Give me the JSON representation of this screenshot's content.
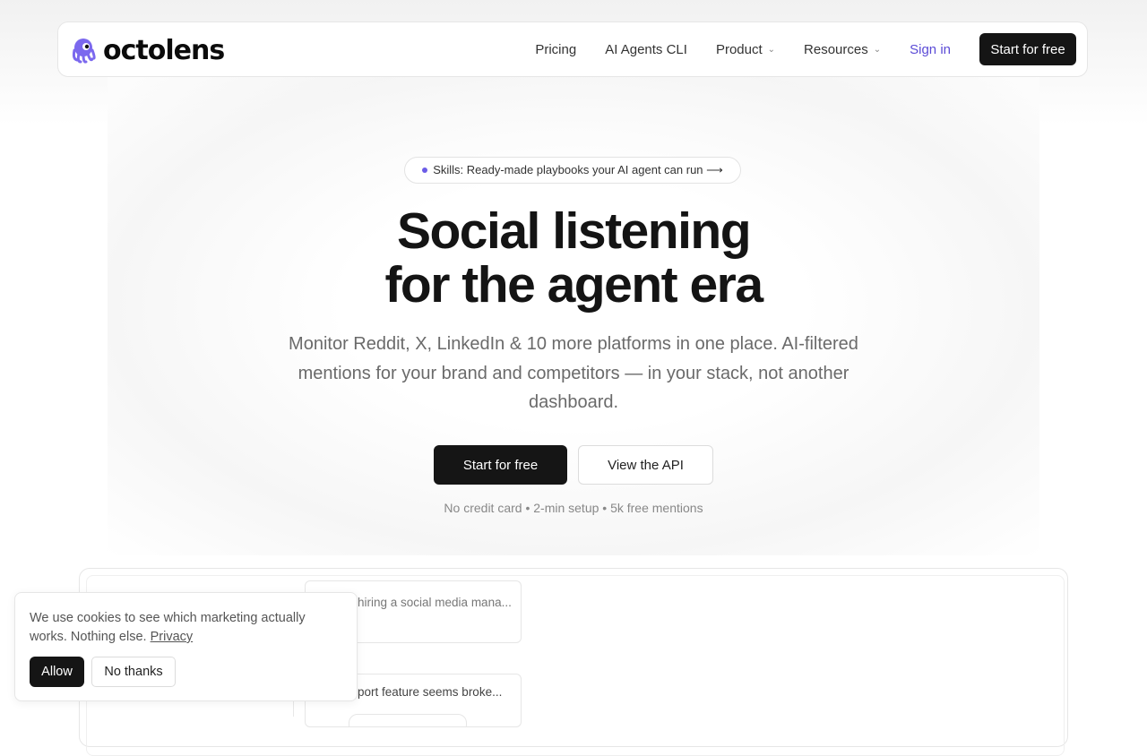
{
  "brand": {
    "name": "octolens",
    "logo_icon": "octopus-icon",
    "accent": "#6b5ce7"
  },
  "nav": {
    "links": [
      {
        "label": "Pricing",
        "has_menu": false
      },
      {
        "label": "AI Agents CLI",
        "has_menu": false
      },
      {
        "label": "Product",
        "has_menu": true
      },
      {
        "label": "Resources",
        "has_menu": true
      }
    ],
    "sign_in": "Sign in",
    "cta": "Start for free"
  },
  "hero": {
    "pill": "Skills: Ready-made playbooks your AI agent can run ⟶",
    "headline_line1": "Social listening",
    "headline_line2": "for the agent era",
    "subtext": "Monitor Reddit, X, LinkedIn & 10 more platforms in one place. AI-filtered mentions for your brand and competitors — in your stack, not another dashboard.",
    "cta_primary": "Start for free",
    "cta_secondary": "View the API",
    "fine_print": "No credit card • 2-min setup • 5k free mentions"
  },
  "preview": {
    "cards": [
      {
        "text": "hiring a social media mana..."
      },
      {
        "text": "port feature seems broke..."
      }
    ]
  },
  "cookie": {
    "message": "We use cookies to see which marketing actually works. Nothing else.",
    "link": "Privacy",
    "allow": "Allow",
    "decline": "No thanks"
  }
}
